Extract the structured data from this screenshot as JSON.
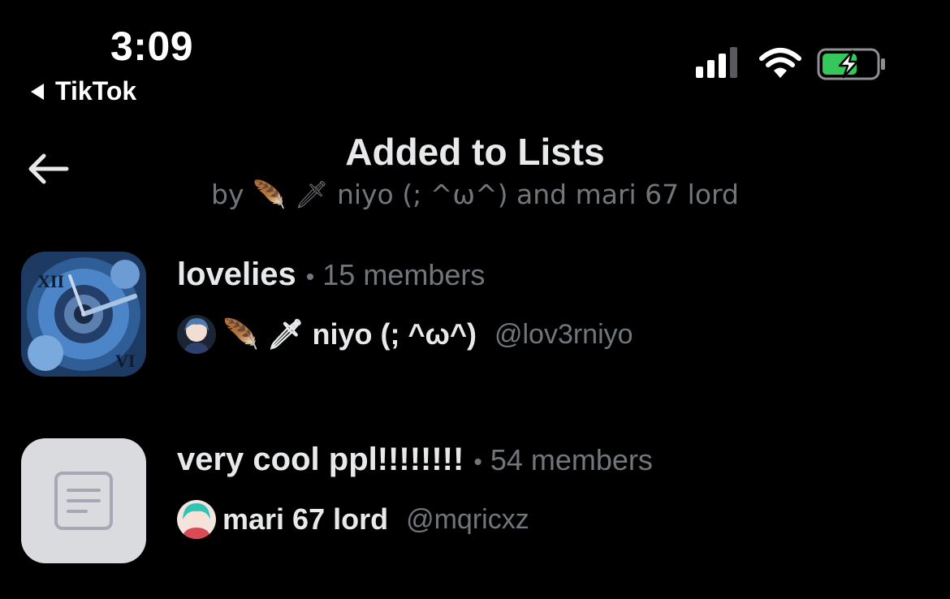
{
  "status_bar": {
    "time": "3:09",
    "back_app": "TikTok"
  },
  "header": {
    "title": "Added to Lists",
    "subtitle": "by 🪶 🗡 niyo (; ^ω^)   and mari 67 lord"
  },
  "lists": [
    {
      "name": "lovelies",
      "separator": "•",
      "members": "15 members",
      "owner_name": "🪶 🗡 niyo (; ^ω^)",
      "owner_handle": "@lov3rniyo"
    },
    {
      "name": "very cool ppl!!!!!!!!",
      "separator": "•",
      "members": "54 members",
      "owner_name": "mari 67 lord",
      "owner_handle": "@mqricxz"
    }
  ],
  "colors": {
    "background": "#000000",
    "text": "#e7e9ea",
    "secondary": "#71767b",
    "battery": "#34c759"
  }
}
